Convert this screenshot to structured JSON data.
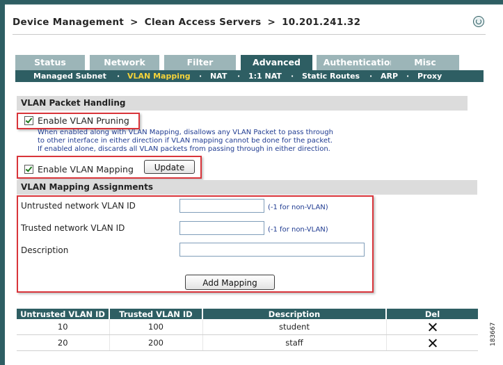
{
  "breadcrumb": {
    "items": [
      "Device Management",
      "Clean Access Servers",
      "10.201.241.32"
    ],
    "separator": ">"
  },
  "tabs": [
    "Status",
    "Network",
    "Filter",
    "Advanced",
    "Authentication",
    "Misc"
  ],
  "active_tab": "Advanced",
  "subnav": {
    "items": [
      "Managed Subnet",
      "VLAN Mapping",
      "NAT",
      "1:1 NAT",
      "Static Routes",
      "ARP",
      "Proxy"
    ],
    "active": "VLAN Mapping",
    "separator": "·"
  },
  "vlan_packet_handling": {
    "title": "VLAN Packet Handling",
    "pruning_label": "Enable VLAN Pruning",
    "pruning_checked": true,
    "help_lines": [
      "When enabled along with VLAN Mapping, disallows any VLAN Packet to pass through",
      "to other interface in either direction if VLAN mapping cannot be done for the packet.",
      "If enabled alone, discards all VLAN packets from passing through in either direction."
    ],
    "mapping_label": "Enable VLAN Mapping",
    "mapping_checked": true,
    "update_button": "Update"
  },
  "assignments": {
    "title": "VLAN Mapping Assignments",
    "untrusted_label": "Untrusted network VLAN ID",
    "untrusted_value": "",
    "untrusted_hint": "(-1 for non-VLAN)",
    "trusted_label": "Trusted network VLAN ID",
    "trusted_value": "",
    "trusted_hint": "(-1 for non-VLAN)",
    "description_label": "Description",
    "description_value": "",
    "add_button": "Add Mapping"
  },
  "table": {
    "columns": [
      "Untrusted VLAN ID",
      "Trusted VLAN ID",
      "Description",
      "Del"
    ],
    "rows": [
      {
        "untrusted": "10",
        "trusted": "100",
        "description": "student"
      },
      {
        "untrusted": "20",
        "trusted": "200",
        "description": "staff"
      }
    ]
  },
  "figure_id": "183667",
  "colors": {
    "accent": "#2e5e63",
    "tab_inactive": "#9cb5b8",
    "subnav_active": "#f5d33a",
    "callout": "#d9343a",
    "help_text": "#1f3b91"
  },
  "icons": [
    "help-icon",
    "checkbox-checked-icon",
    "delete-x-icon"
  ]
}
